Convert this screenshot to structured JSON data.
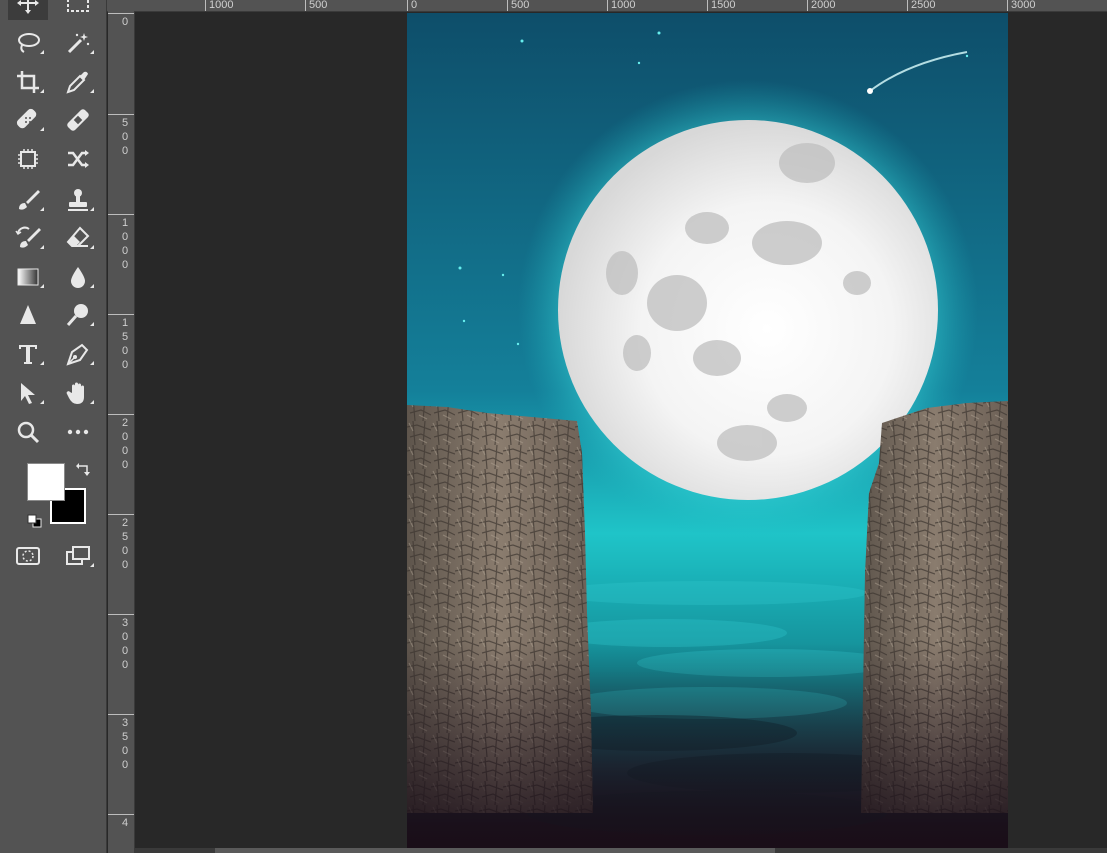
{
  "toolbar": {
    "tools": [
      {
        "id": "move",
        "icon": "move-icon"
      },
      {
        "id": "marquee",
        "icon": "rectangular-marquee-icon"
      },
      {
        "id": "lasso",
        "icon": "lasso-icon"
      },
      {
        "id": "magic-wand",
        "icon": "magic-wand-icon"
      },
      {
        "id": "crop",
        "icon": "crop-icon"
      },
      {
        "id": "eyedropper",
        "icon": "eyedropper-icon"
      },
      {
        "id": "spot-healing",
        "icon": "spot-healing-brush-icon"
      },
      {
        "id": "healing-patch",
        "icon": "bandage-icon"
      },
      {
        "id": "content-aware",
        "icon": "content-aware-move-icon"
      },
      {
        "id": "shuffle",
        "icon": "shuffle-icon"
      },
      {
        "id": "brush",
        "icon": "brush-icon"
      },
      {
        "id": "clone-stamp",
        "icon": "clone-stamp-icon"
      },
      {
        "id": "history-brush",
        "icon": "history-brush-icon"
      },
      {
        "id": "eraser",
        "icon": "eraser-icon"
      },
      {
        "id": "gradient",
        "icon": "gradient-icon"
      },
      {
        "id": "blur",
        "icon": "blur-drop-icon"
      },
      {
        "id": "sharpen",
        "icon": "sharpen-triangle-icon"
      },
      {
        "id": "dodge",
        "icon": "dodge-icon"
      },
      {
        "id": "type",
        "icon": "type-icon"
      },
      {
        "id": "pen",
        "icon": "pen-icon"
      },
      {
        "id": "path-selection",
        "icon": "path-selection-arrow-icon"
      },
      {
        "id": "hand",
        "icon": "hand-icon"
      },
      {
        "id": "zoom",
        "icon": "zoom-icon"
      },
      {
        "id": "more",
        "icon": "more-ellipsis-icon"
      },
      {
        "id": "quick-mask",
        "icon": "quick-mask-icon"
      },
      {
        "id": "screen-mode",
        "icon": "screen-mode-icon"
      }
    ],
    "foreground_color": "#ffffff",
    "background_color": "#000000"
  },
  "ruler": {
    "horizontal_labels": [
      "1000",
      "500",
      "0",
      "500",
      "1000",
      "1500",
      "2000",
      "2500",
      "3000"
    ],
    "vertical_labels": [
      "0",
      "500",
      "1000",
      "1500",
      "2000",
      "2500",
      "3000",
      "3500",
      "4"
    ]
  },
  "document": {
    "sky_top_color": "#0f5e78",
    "sky_glow_color": "#1fd6d6",
    "moon_color": "#f2f2f2",
    "rock_color": "#7a6e62",
    "cloud_color": "#1aa8b4",
    "bottom_color": "#1a0e18"
  }
}
